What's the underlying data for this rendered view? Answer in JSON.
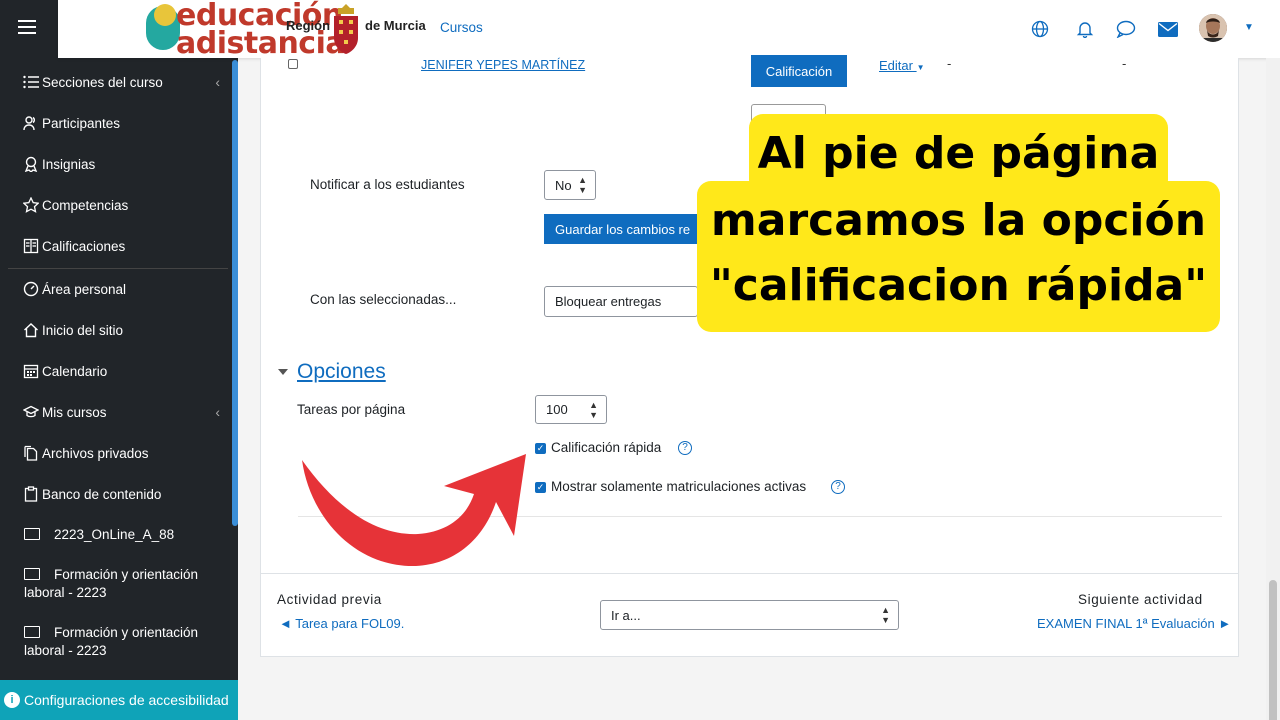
{
  "header": {
    "logo_line1": "educación",
    "logo_line2": "adistancia",
    "region_left": "Región",
    "region_right": "de Murcia",
    "cursos_link": "Cursos",
    "icons": [
      "globe-icon",
      "bell-icon",
      "chat-icon",
      "envelope-icon"
    ]
  },
  "sidebar": {
    "items": [
      {
        "label": "Secciones del curso",
        "icon": "list-icon"
      },
      {
        "label": "Participantes",
        "icon": "users-icon"
      },
      {
        "label": "Insignias",
        "icon": "badge-icon"
      },
      {
        "label": "Competencias",
        "icon": "star-icon"
      },
      {
        "label": "Calificaciones",
        "icon": "book-icon"
      },
      {
        "label": "Área personal",
        "icon": "dashboard-icon"
      },
      {
        "label": "Inicio del sitio",
        "icon": "home-icon"
      },
      {
        "label": "Calendario",
        "icon": "calendar-icon"
      },
      {
        "label": "Mis cursos",
        "icon": "graduation-cap-icon"
      },
      {
        "label": "Archivos privados",
        "icon": "files-icon"
      },
      {
        "label": "Banco de contenido",
        "icon": "clipboard-icon"
      }
    ],
    "folders": [
      {
        "label": "2223_OnLine_A_88"
      },
      {
        "label_line1": "Formación y orientación",
        "label_line2": "laboral - 2223"
      },
      {
        "label_line1": "Formación y orientación",
        "label_line2": "laboral - 2223"
      }
    ],
    "accessibility": "Configuraciones de accesibilidad"
  },
  "main": {
    "student_name": "JENIFER YEPES MARTÍNEZ",
    "grade_button": "Calificación",
    "edit_link": "Editar",
    "dash": "-",
    "notify_label": "Notificar a los estudiantes",
    "notify_value": "No",
    "save_button": "Guardar los cambios re",
    "bulk_label": "Con las seleccionadas...",
    "bulk_value": "Bloquear entregas",
    "options_title": "Opciones",
    "per_page_label": "Tareas por página",
    "per_page_value": "100",
    "quick_grading_label": "Calificación rápida",
    "quick_grading_checked": true,
    "active_only_label": "Mostrar solamente matriculaciones activas",
    "active_only_checked": true
  },
  "footer_nav": {
    "prev_title": "Actividad previa",
    "prev_link": "◄ Tarea para FOL09.",
    "jump_value": "Ir a...",
    "next_title": "Siguiente actividad",
    "next_link": "EXAMEN FINAL 1ª Evaluación ►"
  },
  "callout": {
    "line1": "Al pie de página",
    "line2": "marcamos la opción",
    "line3": "\"calificacion rápida\""
  },
  "colors": {
    "sidebar": "#212529",
    "accent": "#0f6cbf",
    "callout": "#ffe81a",
    "arrow": "#e63338",
    "accessibility": "#0fa3b8"
  }
}
